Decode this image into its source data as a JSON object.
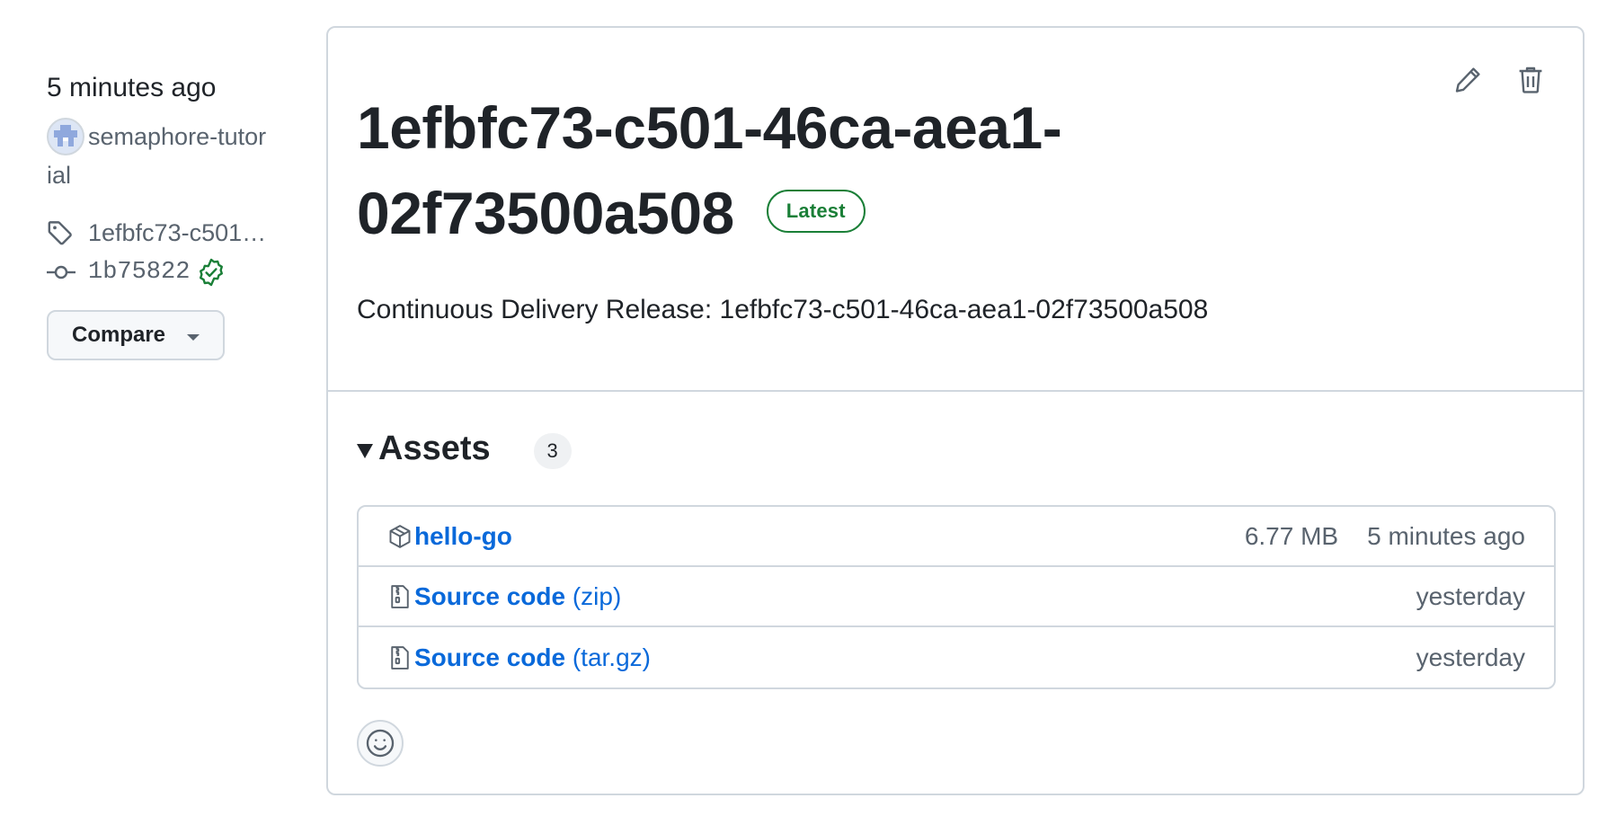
{
  "sidebar": {
    "time": "5 minutes ago",
    "author": "semaphore-tutorial",
    "tag": "1efbfc73-c501-46ca-aea1-02f73500a508",
    "commit": "1b75822",
    "compare_label": "Compare"
  },
  "release": {
    "title": "1efbfc73-c501-46ca-aea1-02f73500a508",
    "badge": "Latest",
    "description": "Continuous Delivery Release: 1efbfc73-c501-46ca-aea1-02f73500a508"
  },
  "assets": {
    "label": "Assets",
    "count": "3",
    "items": [
      {
        "name": "hello-go",
        "format": "",
        "size": "6.77 MB",
        "date": "5 minutes ago",
        "icon": "package-icon"
      },
      {
        "name": "Source code",
        "format": "(zip)",
        "size": "",
        "date": "yesterday",
        "icon": "file-zip-icon"
      },
      {
        "name": "Source code",
        "format": "(tar.gz)",
        "size": "",
        "date": "yesterday",
        "icon": "file-zip-icon"
      }
    ]
  },
  "colors": {
    "link": "#0969da",
    "success": "#1a7f37",
    "muted": "#59636e",
    "border": "#d0d7de"
  }
}
